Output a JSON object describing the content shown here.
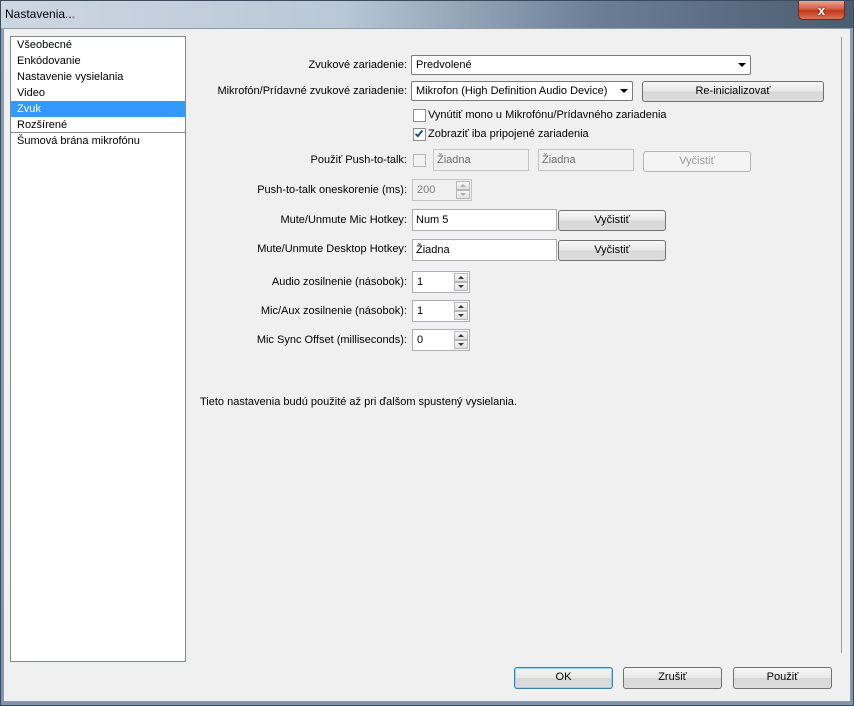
{
  "window": {
    "title": "Nastavenia...",
    "close_label": "x"
  },
  "nav": {
    "items": [
      {
        "label": "Všeobecné",
        "selected": false
      },
      {
        "label": "Enkódovanie",
        "selected": false
      },
      {
        "label": "Nastavenie vysielania",
        "selected": false
      },
      {
        "label": "Video",
        "selected": false
      },
      {
        "label": "Zvuk",
        "selected": true
      },
      {
        "label": "Rozšírené",
        "selected": false
      },
      {
        "label": "Šumová brána mikrofónu",
        "selected": false
      }
    ]
  },
  "audio": {
    "device_label": "Zvukové zariadenie:",
    "device_value": "Predvolené",
    "mic_label": "Mikrofón/Prídavné zvukové zariadenie:",
    "mic_value": "Mikrofon (High Definition Audio Device)",
    "reinit_button": "Re-inicializovať",
    "force_mono_label": "Vynútiť mono u Mikrofónu/Prídavného zariadenia",
    "force_mono_checked": false,
    "show_connected_label": "Zobraziť iba pripojené zariadenia",
    "show_connected_checked": true,
    "ptt_label": "Použiť Push-to-talk:",
    "ptt_checked": false,
    "ptt_hotkey1": "Žiadna",
    "ptt_hotkey2": "Žiadna",
    "ptt_clear_button": "Vyčistiť",
    "ptt_delay_label": "Push-to-talk oneskorenie (ms):",
    "ptt_delay_value": "200",
    "mic_hotkey_label": "Mute/Unmute Mic Hotkey:",
    "mic_hotkey_value": "Num 5",
    "mic_clear_button": "Vyčistiť",
    "desktop_hotkey_label": "Mute/Unmute Desktop Hotkey:",
    "desktop_hotkey_value": "Žiadna",
    "desktop_clear_button": "Vyčistiť",
    "audio_gain_label": "Audio zosilnenie (násobok):",
    "audio_gain_value": "1",
    "mic_gain_label": "Mic/Aux zosilnenie (násobok):",
    "mic_gain_value": "1",
    "sync_offset_label": "Mic Sync Offset (milliseconds):",
    "sync_offset_value": "0",
    "note": "Tieto nastavenia budú použité až pri ďalšom spustený vysielania."
  },
  "footer": {
    "ok_label": "OK",
    "cancel_label": "Zrušiť",
    "apply_label": "Použiť"
  }
}
